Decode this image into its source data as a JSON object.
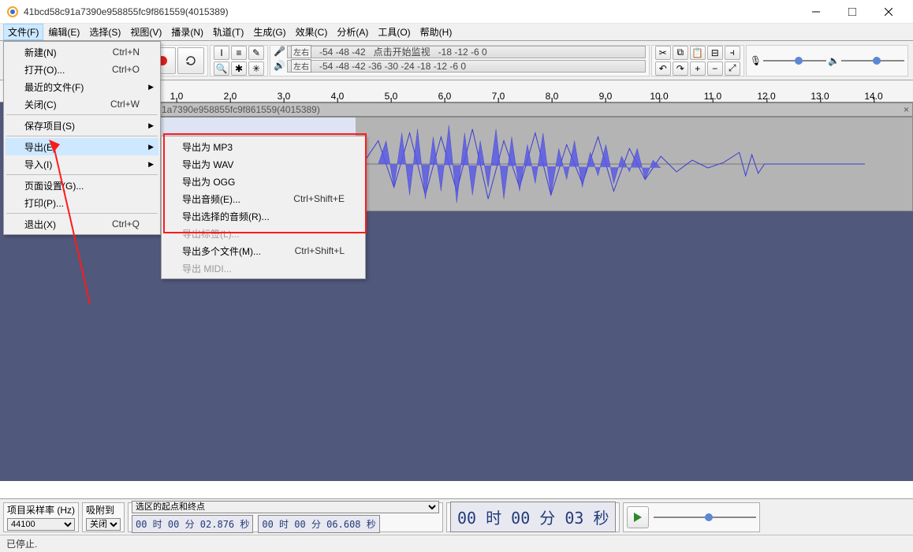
{
  "title": "41bcd58c91a7390e958855fc9f861559(4015389)",
  "menubar": [
    "文件(F)",
    "编辑(E)",
    "选择(S)",
    "视图(V)",
    "播录(N)",
    "轨道(T)",
    "生成(G)",
    "效果(C)",
    "分析(A)",
    "工具(O)",
    "帮助(H)"
  ],
  "file_menu": {
    "new": {
      "label": "新建(N)",
      "shortcut": "Ctrl+N"
    },
    "open": {
      "label": "打开(O)...",
      "shortcut": "Ctrl+O"
    },
    "recent": {
      "label": "最近的文件(F)"
    },
    "close": {
      "label": "关闭(C)",
      "shortcut": "Ctrl+W"
    },
    "save_project": {
      "label": "保存项目(S)"
    },
    "export": {
      "label": "导出(E)"
    },
    "import": {
      "label": "导入(I)"
    },
    "page_setup": {
      "label": "页面设置(G)..."
    },
    "print": {
      "label": "打印(P)..."
    },
    "exit": {
      "label": "退出(X)",
      "shortcut": "Ctrl+Q"
    }
  },
  "export_submenu": {
    "mp3": "导出为 MP3",
    "wav": "导出为 WAV",
    "ogg": "导出为 OGG",
    "audio": {
      "label": "导出音频(E)...",
      "shortcut": "Ctrl+Shift+E"
    },
    "sel_audio": "导出选择的音频(R)...",
    "labels": "导出标签(L)...",
    "multi": {
      "label": "导出多个文件(M)...",
      "shortcut": "Ctrl+Shift+L"
    },
    "midi": "导出 MIDI..."
  },
  "meter": {
    "rec_label": "左右",
    "rec_ticks": "-54  -48  -42",
    "rec_hint": "点击开始监视",
    "rec_ticks2": "-18  -12  -6   0",
    "play_label": "左右",
    "play_ticks": "-54  -48  -42  -36  -30  -24  -18  -12  -6   0"
  },
  "timeline_ticks": [
    "1.0",
    "2.0",
    "3.0",
    "4.0",
    "5.0",
    "6.0",
    "7.0",
    "8.0",
    "9.0",
    "10.0",
    "11.0",
    "12.0",
    "13.0",
    "14.0"
  ],
  "track_title": "1a7390e958855fc9f861559(4015389)",
  "selection": {
    "label": "选区的起点和终点",
    "start": "00 时 00 分 02.876 秒",
    "end": "00 时 00 分 06.608 秒"
  },
  "position": "00 时 00 分 03 秒",
  "sample_rate_label": "项目采样率 (Hz)",
  "sample_rate_value": "44100",
  "snap_label": "吸附到",
  "snap_value": "关闭",
  "status": "已停止."
}
